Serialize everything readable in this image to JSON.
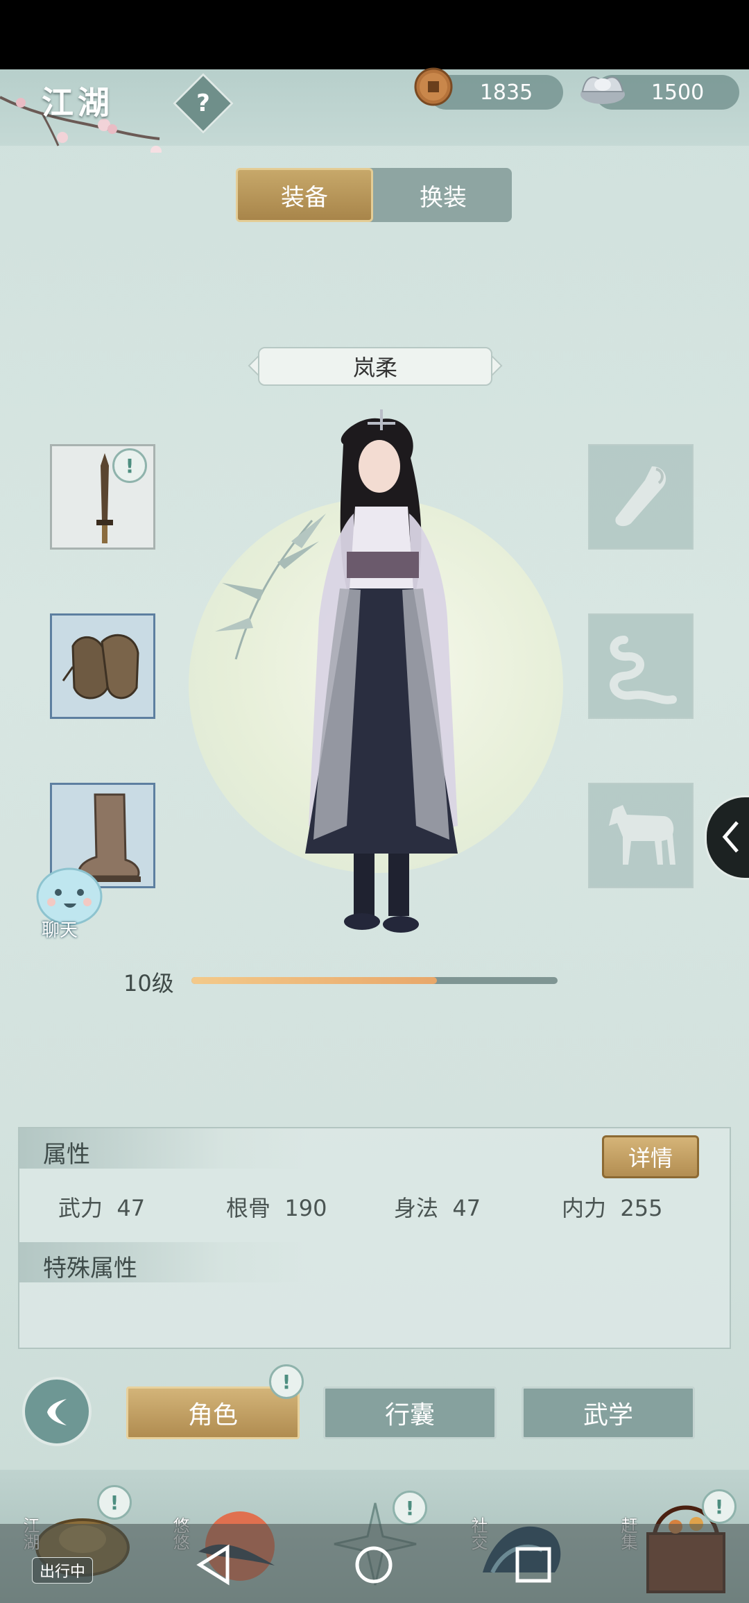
{
  "header": {
    "region_title": "江湖",
    "help_symbol": "?",
    "copper_coins": "1835",
    "silver": "1500"
  },
  "tabs": {
    "equip": "装备",
    "outfit": "换装"
  },
  "character": {
    "name": "岚柔",
    "level": "10级",
    "exp_progress": 0.67
  },
  "attributes": {
    "title": "属性",
    "detail_button": "详情",
    "stats": [
      {
        "label": "武力",
        "value": "47"
      },
      {
        "label": "根骨",
        "value": "190"
      },
      {
        "label": "身法",
        "value": "47"
      },
      {
        "label": "内力",
        "value": "255"
      }
    ],
    "special_title": "特殊属性"
  },
  "chat_label": "聊天",
  "alert_symbol": "!",
  "nav": {
    "character": "角色",
    "bag": "行囊",
    "martial": "武学"
  },
  "dock": {
    "jianghu": "江湖",
    "jianghu_status": "出行中",
    "youyou": "悠悠",
    "social": "社交",
    "market": "赶集"
  },
  "colors": {
    "accent_gold": "#c7a86a",
    "panel_teal": "#86a19e",
    "background": "#d8e6e2"
  }
}
